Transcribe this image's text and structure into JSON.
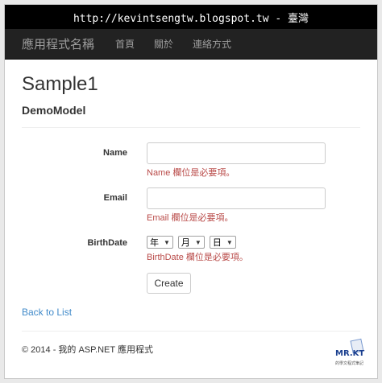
{
  "watermark": {
    "text": "http://kevintsengtw.blogspot.tw - 臺灣"
  },
  "navbar": {
    "brand": "應用程式名稱",
    "links": [
      "首頁",
      "關於",
      "連絡方式"
    ]
  },
  "page": {
    "title": "Sample1",
    "subtitle": "DemoModel"
  },
  "form": {
    "name": {
      "label": "Name",
      "value": "",
      "error": "Name 欄位是必要項。"
    },
    "email": {
      "label": "Email",
      "value": "",
      "error": "Email 欄位是必要項。"
    },
    "birthdate": {
      "label": "BirthDate",
      "year": "年",
      "month": "月",
      "day": "日",
      "error": "BirthDate 欄位是必要項。"
    },
    "submit_label": "Create"
  },
  "back_link": "Back to List",
  "footer": {
    "copyright": "© 2014 - 我的 ASP.NET 應用程式"
  },
  "logo": {
    "text": "MR.KT",
    "subtext": "的學文程式筆記"
  },
  "colors": {
    "navbar_bg": "#222222",
    "error": "#b94a48",
    "link": "#428bca"
  }
}
